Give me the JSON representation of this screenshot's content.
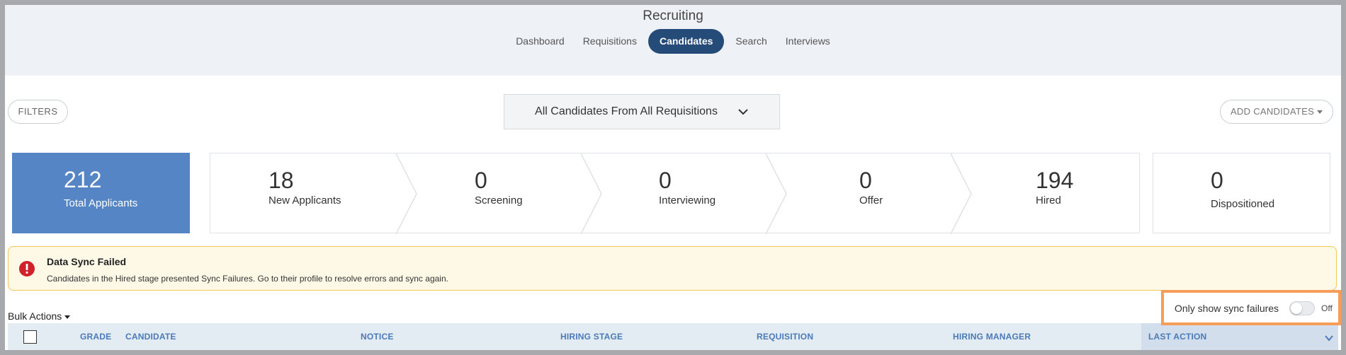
{
  "app": {
    "title": "Recruiting"
  },
  "nav": [
    {
      "label": "Dashboard",
      "active": false
    },
    {
      "label": "Requisitions",
      "active": false
    },
    {
      "label": "Candidates",
      "active": true
    },
    {
      "label": "Search",
      "active": false
    },
    {
      "label": "Interviews",
      "active": false
    }
  ],
  "toolbar": {
    "filters_label": "FILTERS",
    "requisition_select": "All Candidates From All Requisitions",
    "add_candidates_label": "ADD CANDIDATES"
  },
  "summary": {
    "total": {
      "count": "212",
      "label": "Total Applicants"
    },
    "stages": [
      {
        "count": "18",
        "label": "New Applicants"
      },
      {
        "count": "0",
        "label": "Screening"
      },
      {
        "count": "0",
        "label": "Interviewing"
      },
      {
        "count": "0",
        "label": "Offer"
      },
      {
        "count": "194",
        "label": "Hired"
      }
    ],
    "dispositioned": {
      "count": "0",
      "label": "Dispositioned"
    }
  },
  "alert": {
    "title": "Data Sync Failed",
    "message": "Candidates in the Hired stage presented Sync Failures. Go to their profile to resolve errors and sync again."
  },
  "bulk_actions_label": "Bulk Actions",
  "sync_filter": {
    "label": "Only show sync failures",
    "state": "Off"
  },
  "table": {
    "columns": [
      "GRADE",
      "CANDIDATE",
      "NOTICE",
      "HIRING STAGE",
      "REQUISITION",
      "HIRING MANAGER",
      "LAST ACTION"
    ]
  },
  "colors": {
    "accent": "#254b79",
    "total_card": "#5585c4",
    "alert_border": "#f2c94c",
    "highlight": "#f59e5a"
  }
}
